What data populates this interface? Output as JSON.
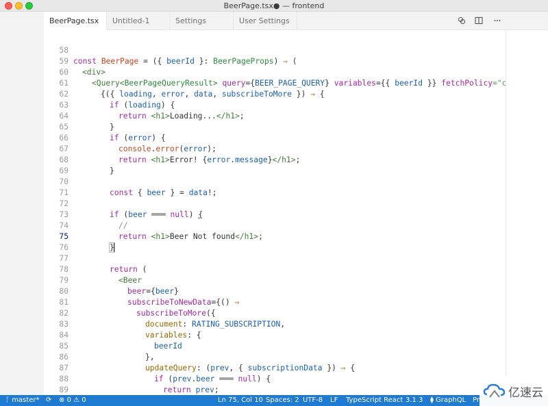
{
  "window": {
    "title": "BeerPage.tsx● — frontend"
  },
  "tabs": [
    {
      "label": "BeerPage.tsx",
      "dirty": true
    },
    {
      "label": "Untitled-1"
    },
    {
      "label": "Settings"
    },
    {
      "label": "User Settings"
    }
  ],
  "tab_icons": [
    "open-changes-icon",
    "split-editor-icon",
    "more-actions-icon"
  ],
  "code": {
    "current_line": "75",
    "lines": [
      {
        "n": "58"
      },
      {
        "n": "59"
      },
      {
        "n": "60"
      },
      {
        "n": "61"
      },
      {
        "n": "62"
      },
      {
        "n": "63"
      },
      {
        "n": "64"
      },
      {
        "n": "65"
      },
      {
        "n": "66"
      },
      {
        "n": "67"
      },
      {
        "n": "68"
      },
      {
        "n": "69"
      },
      {
        "n": "70"
      },
      {
        "n": "71"
      },
      {
        "n": "72"
      },
      {
        "n": "73"
      },
      {
        "n": "74"
      },
      {
        "n": "75"
      },
      {
        "n": "76"
      },
      {
        "n": "77"
      },
      {
        "n": "78"
      },
      {
        "n": "79"
      },
      {
        "n": "80"
      },
      {
        "n": "81"
      },
      {
        "n": "82"
      },
      {
        "n": "83"
      },
      {
        "n": "84"
      },
      {
        "n": "85"
      },
      {
        "n": "86"
      },
      {
        "n": "87"
      },
      {
        "n": "88"
      },
      {
        "n": "89"
      }
    ],
    "text": {
      "l58": [
        "const",
        "BeerPage",
        "= ({",
        "beerId",
        "}:",
        "BeerPageProps",
        ") ",
        "⇒",
        " ("
      ],
      "l59": [
        "<div>"
      ],
      "l60": [
        "<Query<",
        "BeerPageQueryResult",
        ">",
        "query",
        "={",
        "BEER_PAGE_QUERY",
        "}",
        "variables",
        "={{",
        "beerId",
        "}}",
        "fetchPolicy",
        "=\"cache"
      ],
      "l61": [
        "{({",
        "loading",
        ",",
        "error",
        ",",
        "data",
        ",",
        "subscribeToMore",
        "})",
        "⇒",
        "{"
      ],
      "l62": [
        "if",
        "(",
        "loading",
        ") {"
      ],
      "l63": [
        "return",
        "<h1>",
        "Loading...",
        "</h1>",
        ";"
      ],
      "l64": [
        "}"
      ],
      "l65": [
        "if",
        "(",
        "error",
        ") {"
      ],
      "l66": [
        "console",
        ".",
        "error",
        "(",
        "error",
        ");"
      ],
      "l67": [
        "return",
        "<h1>",
        "Error! {",
        "error",
        ".",
        "message",
        "}",
        "</h1>",
        ";"
      ],
      "l68": [
        "}"
      ],
      "l70": [
        "const",
        "{",
        "beer",
        "} =",
        "data",
        "!;"
      ],
      "l72": [
        "if",
        "(",
        "beer",
        "═══",
        "null",
        ")",
        "{"
      ],
      "l73": [
        "//"
      ],
      "l74": [
        "return",
        "<h1>",
        "Beer Not found",
        "</h1>",
        ";"
      ],
      "l75": [
        "}"
      ],
      "l77": [
        "return",
        "("
      ],
      "l78": [
        "<Beer"
      ],
      "l79": [
        "beer",
        "={",
        "beer",
        "}"
      ],
      "l80": [
        "subscribeToNewData",
        "={()",
        "⇒"
      ],
      "l81": [
        "subscribeToMore",
        "({"
      ],
      "l82": [
        "document",
        ":",
        "RATING_SUBSCRIPTION",
        ","
      ],
      "l83": [
        "variables",
        ": {"
      ],
      "l84": [
        "beerId"
      ],
      "l85": [
        "},"
      ],
      "l86": [
        "updateQuery",
        ": (",
        "prev",
        ", {",
        "subscriptionData",
        "})",
        "⇒",
        "{"
      ],
      "l87": [
        "if",
        "(",
        "prev",
        ".",
        "beer",
        "═══",
        "null",
        ") {"
      ],
      "l88": [
        "return",
        "prev",
        ";"
      ],
      "l89": [
        "}"
      ]
    }
  },
  "status": {
    "branch": "master*",
    "sync_icon": "sync-icon",
    "errors": "0",
    "warnings": "0",
    "position": "Ln 75, Col 10",
    "spaces": "Spaces: 2",
    "encoding": "UTF-8",
    "eol": "LF",
    "language": "TypeScript React",
    "version": "3.1.3",
    "graphql": "GraphQL",
    "trailing": "Pr"
  },
  "watermark": {
    "text": "亿速云"
  },
  "colors": {
    "statusbar": "#1f7ad1",
    "keyword": "#a626a4",
    "tag": "#50a14f",
    "variable": "#1a5fb4",
    "attribute": "#986801",
    "arrow": "#b76a1a"
  }
}
